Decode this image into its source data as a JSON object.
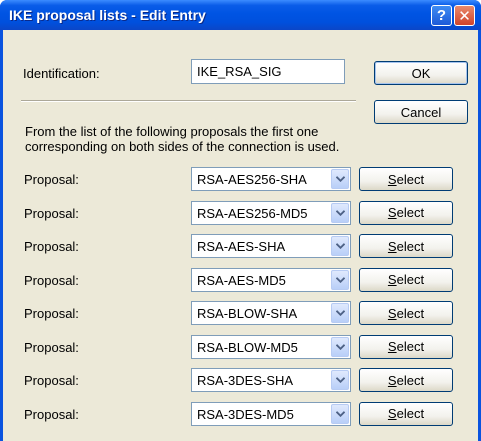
{
  "window": {
    "title": "IKE proposal lists - Edit Entry",
    "help_glyph": "?",
    "close_glyph": "✕"
  },
  "form": {
    "identification_label": "Identification:",
    "identification_value": "IKE_RSA_SIG",
    "info_line1": "From the list of the following proposals the first one",
    "info_line2": "corresponding on both sides of the connection is used."
  },
  "buttons": {
    "ok": "OK",
    "cancel": "Cancel",
    "select_mnemonic": "S",
    "select_rest": "elect"
  },
  "proposal_label": "Proposal:",
  "proposals": [
    "RSA-AES256-SHA",
    "RSA-AES256-MD5",
    "RSA-AES-SHA",
    "RSA-AES-MD5",
    "RSA-BLOW-SHA",
    "RSA-BLOW-MD5",
    "RSA-3DES-SHA",
    "RSA-3DES-MD5"
  ],
  "colors": {
    "title_bar": "#0054e3",
    "dialog_bg": "#ece9d8",
    "close_button": "#d0432a"
  },
  "icons": [
    "help-icon",
    "close-icon",
    "chevron-down-icon"
  ]
}
